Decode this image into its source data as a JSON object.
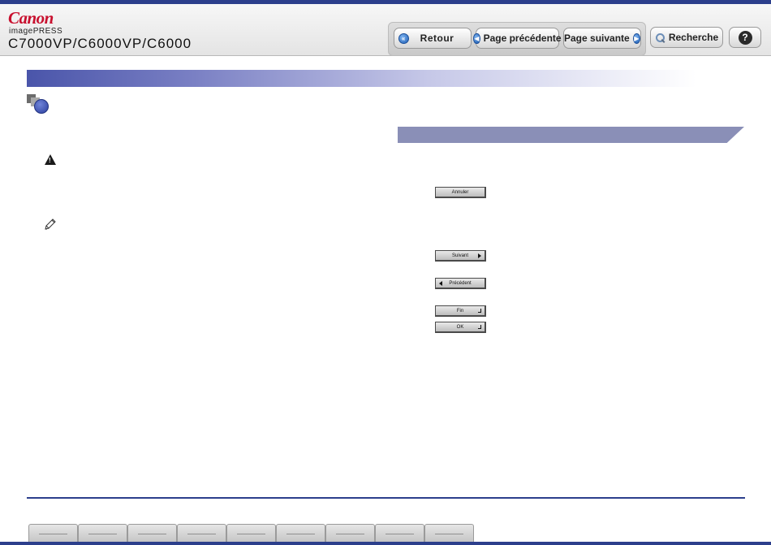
{
  "brand": {
    "logo": "Canon",
    "product_line": "imagePRESS",
    "model": "C7000VP/C6000VP/C6000"
  },
  "nav": {
    "back_label": "Retour",
    "prev_page_label": "Page précédente",
    "next_page_label": "Page suivante",
    "search_label": "Recherche",
    "help_label": "?"
  },
  "icons": {
    "back": "double-left-arrow-icon",
    "prev": "left-arrow-icon",
    "next": "right-arrow-icon",
    "search": "magnifier-icon",
    "help": "question-icon",
    "warning": "warning-icon",
    "note": "pencil-note-icon",
    "chapter": "chapter-marker-icon"
  },
  "screen_buttons": {
    "cancel": "Annuler",
    "next": "Suivant",
    "previous": "Précédent",
    "finish": "Fin",
    "ok": "OK"
  },
  "colors": {
    "accent": "#2c3f8c",
    "section_bar": "#8a8fb7",
    "brand_red": "#c8102e"
  }
}
